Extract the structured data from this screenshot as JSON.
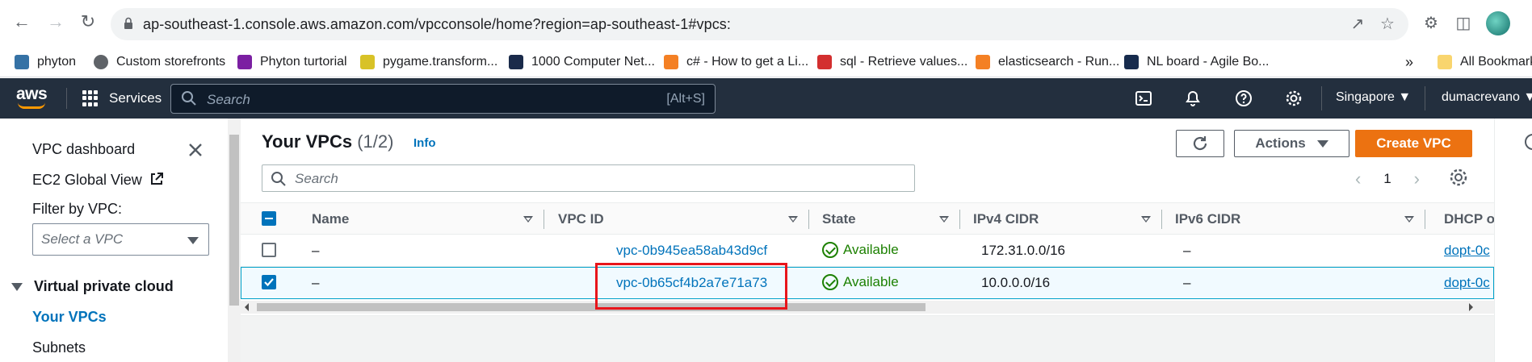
{
  "browser": {
    "url": "ap-southeast-1.console.aws.amazon.com/vpcconsole/home?region=ap-southeast-1#vpcs:",
    "bookmarks": [
      {
        "label": "phyton",
        "icon": "python-icon",
        "color": "#3572a5"
      },
      {
        "label": "Custom storefronts",
        "icon": "globe-icon",
        "color": "#5f6368"
      },
      {
        "label": "Phyton turtorial",
        "icon": "bookmark-p-icon",
        "color": "#7b1fa2"
      },
      {
        "label": "pygame.transform...",
        "icon": "pygame-icon",
        "color": "#d8c227"
      },
      {
        "label": "1000 Computer Net...",
        "icon": "sf-icon",
        "color": "#1a2a4a"
      },
      {
        "label": "c# - How to get a Li...",
        "icon": "stackoverflow-icon",
        "color": "#f48024"
      },
      {
        "label": "sql - Retrieve values...",
        "icon": "sql-icon",
        "color": "#d32f2f"
      },
      {
        "label": "elasticsearch - Run...",
        "icon": "stackoverflow-icon",
        "color": "#f48024"
      },
      {
        "label": "NL board - Agile Bo...",
        "icon": "jira-icon",
        "color": "#172b4d"
      }
    ],
    "overflow": "»",
    "all_bookmarks": "All Bookmarks"
  },
  "aws": {
    "logo": "aws",
    "services": "Services",
    "search_placeholder": "Search",
    "search_shortcut": "[Alt+S]",
    "region": "Singapore",
    "user": "dumacrevano"
  },
  "sidebar": {
    "items": [
      "VPC dashboard",
      "EC2 Global View"
    ],
    "filter_label": "Filter by VPC:",
    "filter_placeholder": "Select a VPC",
    "section": "Virtual private cloud",
    "sub_items": [
      "Your VPCs",
      "Subnets"
    ]
  },
  "panel": {
    "title": "Your VPCs",
    "count": "(1/2)",
    "info": "Info",
    "actions": "Actions",
    "create": "Create VPC",
    "search_placeholder": "Search",
    "page": "1"
  },
  "table": {
    "columns": [
      "Name",
      "VPC ID",
      "State",
      "IPv4 CIDR",
      "IPv6 CIDR",
      "DHCP o"
    ],
    "rows": [
      {
        "name": "–",
        "vpc_id": "vpc-0b945ea58ab43d9cf",
        "state": "Available",
        "ipv4": "172.31.0.0/16",
        "ipv6": "–",
        "dhcp": "dopt-0c",
        "selected": false
      },
      {
        "name": "–",
        "vpc_id": "vpc-0b65cf4b2a7e71a73",
        "state": "Available",
        "ipv4": "10.0.0.0/16",
        "ipv6": "–",
        "dhcp": "dopt-0c",
        "selected": true
      }
    ]
  },
  "colors": {
    "aws_header": "#232f3e",
    "primary_button": "#ec7211",
    "link": "#0073bb",
    "status_ok": "#1d8102",
    "highlight": "#e8151b"
  }
}
